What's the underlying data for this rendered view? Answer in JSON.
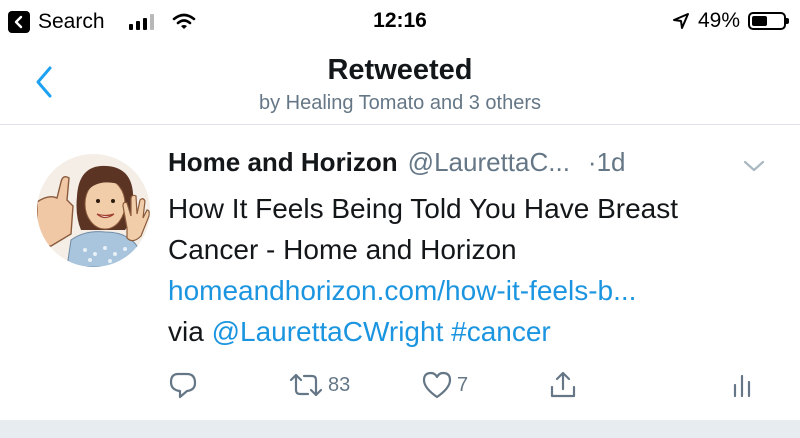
{
  "status_bar": {
    "back_app_label": "Search",
    "time": "12:16",
    "battery_percent": "49%",
    "battery_level": 0.49,
    "signal_bars_active": 3,
    "signal_bars_total": 4
  },
  "header": {
    "title": "Retweeted",
    "subtitle": "by Healing Tomato and 3 others"
  },
  "tweet": {
    "author_name": "Home and Horizon",
    "author_handle": "@LaurettaC...",
    "time": "·1d",
    "text_line1": "How It Feels Being Told You Have Breast",
    "text_line2": "Cancer - Home and Horizon",
    "link_text": "homeandhorizon.com/how-it-feels-b...",
    "via_text": "via",
    "mention": "@LaurettaCWright",
    "hashtag": "#cancer",
    "retweet_count": "83",
    "like_count": "7"
  },
  "colors": {
    "link": "#1b95e0",
    "secondary_text": "#657786",
    "primary_text": "#14171a",
    "divider": "#dfe3e7"
  },
  "icons": [
    "back-app-icon",
    "signal-icon",
    "wifi-icon",
    "location-icon",
    "battery-icon",
    "back-chevron-icon",
    "caret-down-icon",
    "reply-icon",
    "retweet-icon",
    "like-icon",
    "share-icon",
    "analytics-icon"
  ]
}
